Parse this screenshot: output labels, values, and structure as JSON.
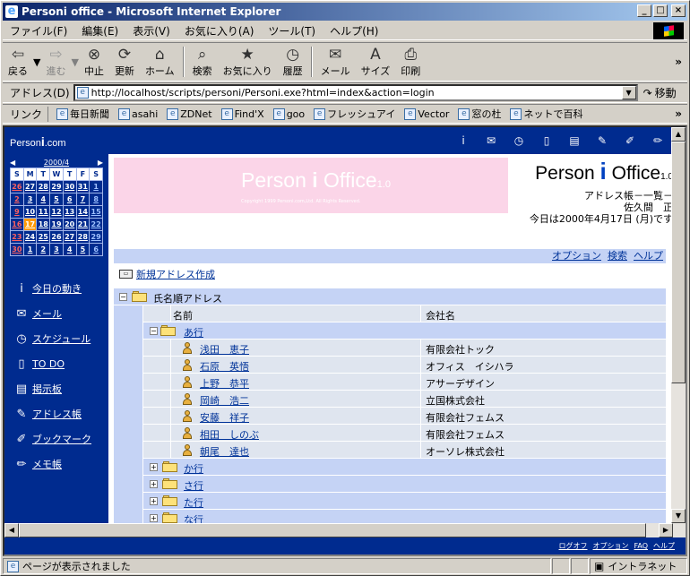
{
  "window": {
    "title": "Personi office - Microsoft Internet Explorer",
    "minimize": "_",
    "maximize": "□",
    "close": "×"
  },
  "menu": [
    "ファイル(F)",
    "編集(E)",
    "表示(V)",
    "お気に入り(A)",
    "ツール(T)",
    "ヘルプ(H)"
  ],
  "toolbar": {
    "back": "戻る",
    "forward": "進む",
    "stop": "中止",
    "refresh": "更新",
    "home": "ホーム",
    "search": "検索",
    "favorites": "お気に入り",
    "history": "履歴",
    "mail": "メール",
    "size": "サイズ",
    "print": "印刷"
  },
  "address": {
    "label": "アドレス(D)",
    "url": "http://localhost/scripts/personi/Personi.exe?html=index&action=login",
    "go": "移動"
  },
  "links": {
    "label": "リンク",
    "items": [
      "毎日新聞",
      "asahi",
      "ZDNet",
      "Find'X",
      "goo",
      "フレッシュアイ",
      "Vector",
      "窓の杜",
      "ネットで百科"
    ]
  },
  "page": {
    "logo_small": "Person",
    "logo_small_i": "i",
    "logo_small_com": ".com",
    "banner_text": "Person",
    "banner_i": "i",
    "banner_office": "Office",
    "banner_ver": "1.0",
    "banner_copyright": "Copyright 1999 Personi.com,Ltd. All Rights Reserved.",
    "brand_text": "Person",
    "brand_i": "i",
    "brand_office": "Office",
    "brand_ver": "1.0",
    "section": "アドレス帳－一覧－",
    "user": "佐久間　正",
    "date_line": "今日は2000年4月17日 (月)です",
    "options_links": [
      "オプション",
      "検索",
      "ヘルプ"
    ],
    "new_address": "新規アドレス作成",
    "root_title": "氏名順アドレス",
    "col_name": "名前",
    "col_company": "会社名",
    "group_a": "あ行",
    "entries": [
      {
        "name": "浅田　恵子",
        "company": "有限会社トック"
      },
      {
        "name": "石原　英悟",
        "company": "オフィス　イシハラ"
      },
      {
        "name": "上野　恭平",
        "company": "アサーデザイン"
      },
      {
        "name": "岡崎　浩二",
        "company": "立国株式会社"
      },
      {
        "name": "安藤　祥子",
        "company": "有限会社フェムス"
      },
      {
        "name": "相田　しのぶ",
        "company": "有限会社フェムス"
      },
      {
        "name": "朝尾　達也",
        "company": "オーソレ株式会社"
      }
    ],
    "other_groups": [
      "か行",
      "さ行",
      "た行",
      "な行"
    ],
    "footer_links": [
      "ログオフ",
      "オプション",
      "FAQ",
      "ヘルプ"
    ]
  },
  "calendar": {
    "month": "2000/4",
    "prev": "◀",
    "next": "▶",
    "dow": [
      "S",
      "M",
      "T",
      "W",
      "T",
      "F",
      "S"
    ],
    "weeks": [
      [
        "26",
        "27",
        "28",
        "29",
        "30",
        "31",
        "1"
      ],
      [
        "2",
        "3",
        "4",
        "5",
        "6",
        "7",
        "8"
      ],
      [
        "9",
        "10",
        "11",
        "12",
        "13",
        "14",
        "15"
      ],
      [
        "16",
        "17",
        "18",
        "19",
        "20",
        "21",
        "22"
      ],
      [
        "23",
        "24",
        "25",
        "26",
        "27",
        "28",
        "29"
      ],
      [
        "30",
        "1",
        "2",
        "3",
        "4",
        "5",
        "6"
      ]
    ],
    "today": "17"
  },
  "sidebar": [
    "今日の動き",
    "メール",
    "スケジュール",
    "TO DO",
    "掲示板",
    "アドレス帳",
    "ブックマーク",
    "メモ帳"
  ],
  "status": {
    "text": "ページが表示されました",
    "zone": "イントラネット"
  }
}
